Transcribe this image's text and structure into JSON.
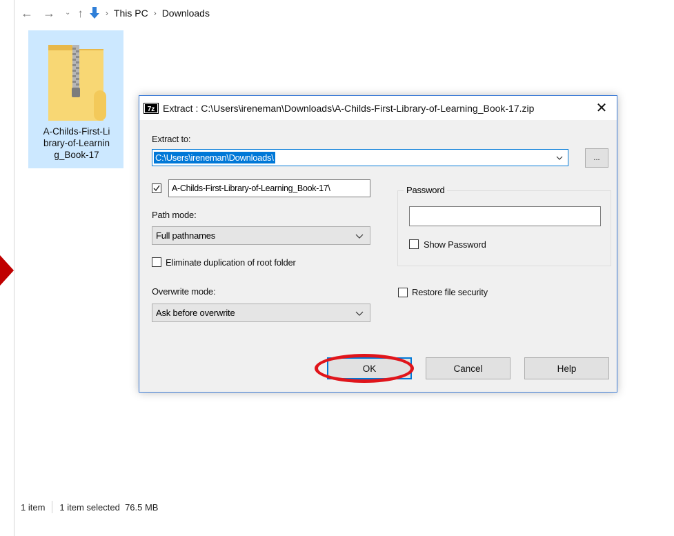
{
  "explorer": {
    "nav": {
      "back": "←",
      "forward": "→",
      "recent": "⌄",
      "up": "↑"
    },
    "breadcrumb": [
      "This PC",
      "Downloads"
    ],
    "separator": "›",
    "file": {
      "name": "A-Childs-First-Li\nbrary-of-Learnin\ng_Book-17"
    },
    "status": {
      "count": "1 item",
      "selected": "1 item selected  76.5 MB"
    }
  },
  "dialog": {
    "title": "Extract : C:\\Users\\ireneman\\Downloads\\A-Childs-First-Library-of-Learning_Book-17.zip",
    "close": "✕",
    "extract_to_label": "Extract to:",
    "extract_to_value": "C:\\Users\\ireneman\\Downloads\\",
    "browse_label": "...",
    "subfolder_value": "A-Childs-First-Library-of-Learning_Book-17\\",
    "subfolder_checked": true,
    "path_mode_label": "Path mode:",
    "path_mode_value": "Full pathnames",
    "eliminate_label": "Eliminate duplication of root folder",
    "overwrite_label": "Overwrite mode:",
    "overwrite_value": "Ask before overwrite",
    "password_legend": "Password",
    "password_value": "",
    "show_password_label": "Show Password",
    "restore_security_label": "Restore file security",
    "buttons": {
      "ok": "OK",
      "cancel": "Cancel",
      "help": "Help"
    }
  },
  "colors": {
    "accent": "#0078d7",
    "selection": "#cce8ff",
    "annotation": "#e0151b",
    "arrow": "#c00000"
  }
}
